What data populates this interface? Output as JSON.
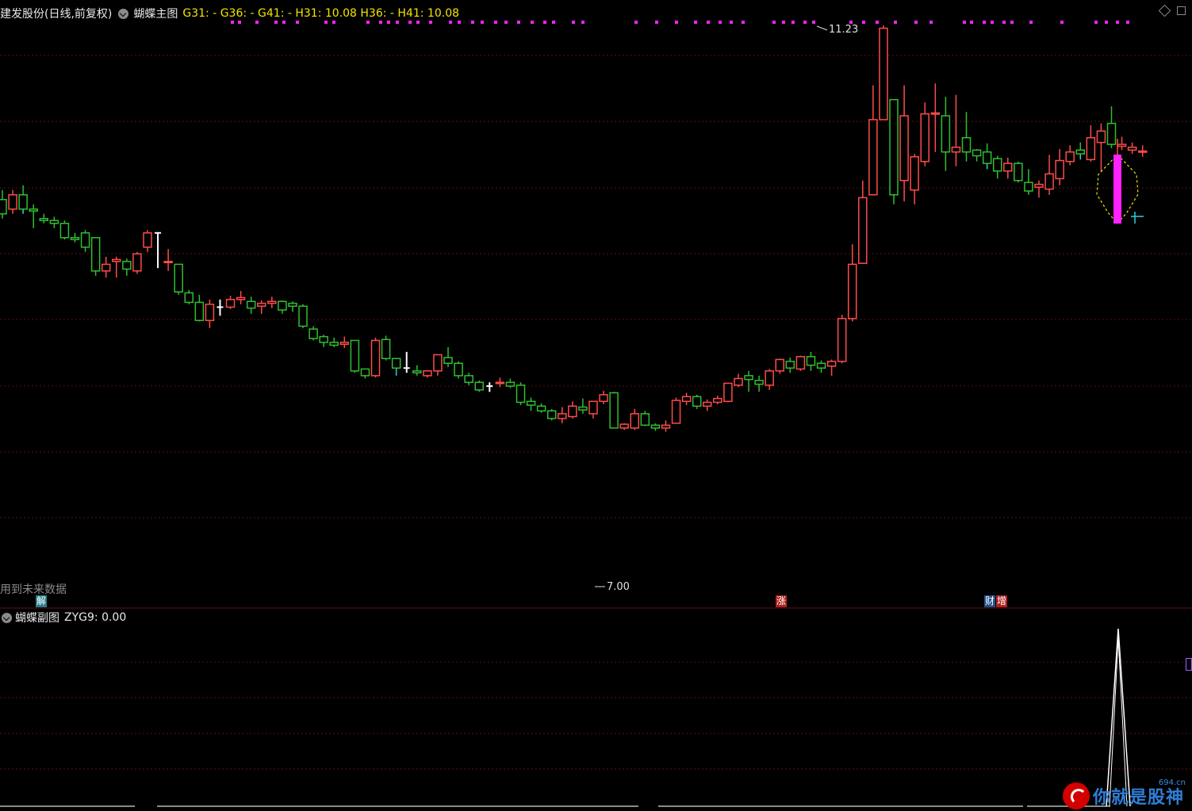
{
  "header": {
    "stock_title": "建发股份(日线,前复权)",
    "indicator_name": "蝴蝶主图",
    "indicator_values": "G31: -  G36: -  G41: -  H31: 10.08  H36: -  H41: 10.08"
  },
  "labels": {
    "future_data_note": "用到未来数据",
    "high_price": "11.23",
    "low_price": "7.00"
  },
  "tags": {
    "jie": "解",
    "zhang": "涨",
    "cai": "财",
    "zeng": "增"
  },
  "sub_panel": {
    "name": "蝴蝶副图",
    "value_text": "ZYG9: 0.00"
  },
  "watermark": {
    "text": "你就是股神",
    "site": "694.cn"
  },
  "colors": {
    "background": "#000000",
    "up": "#ff4a4a",
    "down": "#2fbf2f",
    "cyan": "#2fd0e0",
    "magenta": "#ff22ff",
    "yellow": "#f2e500",
    "grid": "#5a0f0f"
  },
  "chart_data": {
    "type": "candlestick",
    "price_range": [
      6.8,
      11.5
    ],
    "max": 11.23,
    "min": 7.0,
    "candles": [
      [
        9.4,
        9.25,
        9.5,
        9.2
      ],
      [
        9.3,
        9.45,
        9.5,
        9.25
      ],
      [
        9.45,
        9.3,
        9.55,
        9.25
      ],
      [
        9.3,
        9.28,
        9.35,
        9.1
      ],
      [
        9.2,
        9.18,
        9.25,
        9.15
      ],
      [
        9.18,
        9.15,
        9.22,
        9.1
      ],
      [
        9.15,
        9.0,
        9.18,
        8.98
      ],
      [
        9.0,
        8.98,
        9.05,
        8.95
      ],
      [
        9.05,
        8.9,
        9.08,
        8.85
      ],
      [
        9.0,
        8.65,
        9.0,
        8.6
      ],
      [
        8.65,
        8.72,
        8.8,
        8.58
      ],
      [
        8.75,
        8.77,
        8.8,
        8.58
      ],
      [
        8.75,
        8.67,
        8.78,
        8.6
      ],
      [
        8.65,
        8.83,
        8.85,
        8.62
      ],
      [
        8.9,
        9.05,
        9.08,
        8.85
      ],
      [
        9.05,
        8.75,
        9.05,
        8.68
      ],
      [
        8.75,
        8.75,
        8.88,
        8.65
      ],
      [
        8.72,
        8.43,
        8.72,
        8.4
      ],
      [
        8.42,
        8.32,
        8.45,
        8.3
      ],
      [
        8.32,
        8.13,
        8.4,
        8.12
      ],
      [
        8.13,
        8.3,
        8.35,
        8.05
      ],
      [
        8.27,
        8.27,
        8.35,
        8.18
      ],
      [
        8.27,
        8.35,
        8.39,
        8.25
      ],
      [
        8.35,
        8.37,
        8.44,
        8.3
      ],
      [
        8.33,
        8.26,
        8.38,
        8.2
      ],
      [
        8.28,
        8.31,
        8.34,
        8.2
      ],
      [
        8.31,
        8.33,
        8.38,
        8.26
      ],
      [
        8.33,
        8.24,
        8.34,
        8.2
      ],
      [
        8.31,
        8.28,
        8.33,
        8.22
      ],
      [
        8.28,
        8.07,
        8.3,
        8.05
      ],
      [
        8.04,
        7.94,
        8.07,
        7.92
      ],
      [
        7.96,
        7.9,
        7.98,
        7.85
      ],
      [
        7.9,
        7.87,
        7.95,
        7.85
      ],
      [
        7.88,
        7.9,
        7.96,
        7.84
      ],
      [
        7.92,
        7.6,
        7.92,
        7.58
      ],
      [
        7.62,
        7.55,
        7.6,
        7.52
      ],
      [
        7.55,
        7.92,
        7.95,
        7.53
      ],
      [
        7.93,
        7.73,
        7.97,
        7.71
      ],
      [
        7.73,
        7.63,
        7.72,
        7.55
      ],
      [
        7.63,
        7.63,
        7.8,
        7.58
      ],
      [
        7.6,
        7.58,
        7.66,
        7.55
      ],
      [
        7.55,
        7.6,
        7.6,
        7.53
      ],
      [
        7.6,
        7.77,
        7.77,
        7.55
      ],
      [
        7.74,
        7.68,
        7.85,
        7.64
      ],
      [
        7.68,
        7.55,
        7.7,
        7.52
      ],
      [
        7.55,
        7.48,
        7.58,
        7.45
      ],
      [
        7.48,
        7.4,
        7.5,
        7.38
      ],
      [
        7.44,
        7.46,
        7.48,
        7.38
      ],
      [
        7.47,
        7.48,
        7.53,
        7.43
      ],
      [
        7.48,
        7.44,
        7.52,
        7.42
      ],
      [
        7.45,
        7.27,
        7.48,
        7.24
      ],
      [
        7.28,
        7.24,
        7.32,
        7.18
      ],
      [
        7.23,
        7.18,
        7.26,
        7.16
      ],
      [
        7.18,
        7.1,
        7.2,
        7.08
      ],
      [
        7.1,
        7.15,
        7.22,
        7.05
      ],
      [
        7.12,
        7.23,
        7.28,
        7.1
      ],
      [
        7.22,
        7.19,
        7.31,
        7.15
      ],
      [
        7.15,
        7.28,
        7.28,
        7.1
      ],
      [
        7.28,
        7.35,
        7.39,
        7.25
      ],
      [
        7.37,
        7.0,
        7.38,
        7.0
      ],
      [
        7.0,
        7.04,
        7.05,
        6.98
      ],
      [
        7.0,
        7.15,
        7.2,
        6.98
      ],
      [
        7.15,
        7.03,
        7.18,
        7.02
      ],
      [
        7.03,
        7.0,
        7.05,
        6.97
      ],
      [
        7.0,
        7.03,
        7.08,
        6.96
      ],
      [
        7.05,
        7.29,
        7.32,
        7.05
      ],
      [
        7.28,
        7.33,
        7.37,
        7.24
      ],
      [
        7.33,
        7.23,
        7.35,
        7.2
      ],
      [
        7.23,
        7.27,
        7.3,
        7.18
      ],
      [
        7.27,
        7.31,
        7.34,
        7.25
      ],
      [
        7.28,
        7.47,
        7.47,
        7.27
      ],
      [
        7.45,
        7.52,
        7.57,
        7.43
      ],
      [
        7.55,
        7.51,
        7.6,
        7.38
      ],
      [
        7.5,
        7.46,
        7.55,
        7.38
      ],
      [
        7.45,
        7.6,
        7.62,
        7.4
      ],
      [
        7.6,
        7.72,
        7.73,
        7.57
      ],
      [
        7.7,
        7.63,
        7.74,
        7.58
      ],
      [
        7.62,
        7.75,
        7.76,
        7.6
      ],
      [
        7.75,
        7.66,
        7.8,
        7.6
      ],
      [
        7.68,
        7.63,
        7.71,
        7.58
      ],
      [
        7.65,
        7.7,
        7.72,
        7.55
      ],
      [
        7.7,
        8.15,
        8.19,
        7.68
      ],
      [
        8.15,
        8.72,
        8.93,
        8.12
      ],
      [
        8.73,
        9.42,
        9.6,
        9.3
      ],
      [
        9.45,
        10.24,
        10.6,
        9.88
      ],
      [
        10.24,
        11.2,
        11.23,
        10.28
      ],
      [
        10.45,
        9.45,
        10.45,
        9.35
      ],
      [
        9.6,
        10.28,
        10.6,
        9.38
      ],
      [
        9.5,
        9.85,
        9.88,
        9.35
      ],
      [
        9.8,
        10.3,
        10.42,
        9.75
      ],
      [
        10.3,
        10.31,
        10.62,
        9.9
      ],
      [
        10.28,
        9.9,
        10.48,
        9.7
      ],
      [
        9.9,
        9.95,
        10.5,
        9.75
      ],
      [
        10.05,
        9.9,
        10.32,
        9.8
      ],
      [
        9.92,
        9.86,
        9.93,
        9.8
      ],
      [
        9.9,
        9.78,
        9.99,
        9.72
      ],
      [
        9.83,
        9.7,
        9.86,
        9.62
      ],
      [
        9.7,
        9.78,
        9.84,
        9.62
      ],
      [
        9.78,
        9.6,
        9.8,
        9.58
      ],
      [
        9.58,
        9.49,
        9.72,
        9.45
      ],
      [
        9.53,
        9.56,
        9.6,
        9.42
      ],
      [
        9.51,
        9.67,
        9.87,
        9.45
      ],
      [
        9.62,
        9.81,
        9.93,
        9.55
      ],
      [
        9.8,
        9.9,
        9.97,
        9.76
      ],
      [
        9.92,
        9.88,
        10.0,
        9.82
      ],
      [
        9.82,
        10.05,
        10.18,
        9.8
      ],
      [
        10.0,
        10.12,
        10.2,
        9.7
      ],
      [
        10.2,
        9.98,
        10.38,
        9.94
      ],
      [
        9.96,
        9.98,
        10.06,
        9.92
      ],
      [
        9.92,
        9.95,
        10.0,
        9.88
      ],
      [
        9.9,
        9.91,
        9.97,
        9.85
      ]
    ]
  }
}
